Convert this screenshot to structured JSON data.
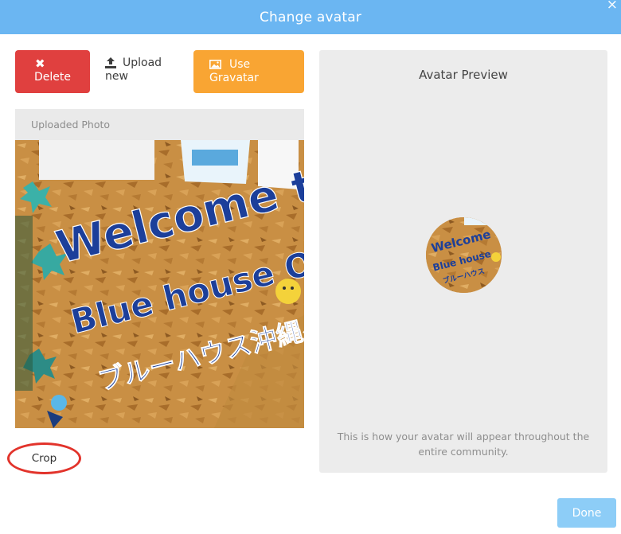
{
  "dialog": {
    "title": "Change avatar",
    "close_symbol": "×"
  },
  "actions": {
    "delete_icon": "✖",
    "delete_label": "Delete",
    "upload_line1": "Upload",
    "upload_line2": "new",
    "gravatar_line1": "Use",
    "gravatar_line2": "Gravatar"
  },
  "uploaded": {
    "label": "Uploaded Photo",
    "crop_label": "Crop"
  },
  "preview": {
    "title": "Avatar Preview",
    "note": "This is how your avatar will appear throughout the entire community."
  },
  "footer": {
    "done_label": "Done"
  },
  "photo": {
    "line1": "Welcome to",
    "line2": "Blue house Okinawa",
    "line3": "ブルーハウス沖縄へようこそ!"
  },
  "colors": {
    "header": "#6bb6f2",
    "delete": "#e0403f",
    "gravatar": "#f9a533",
    "done": "#8dcdf7",
    "crop_highlight": "#e2332b"
  }
}
